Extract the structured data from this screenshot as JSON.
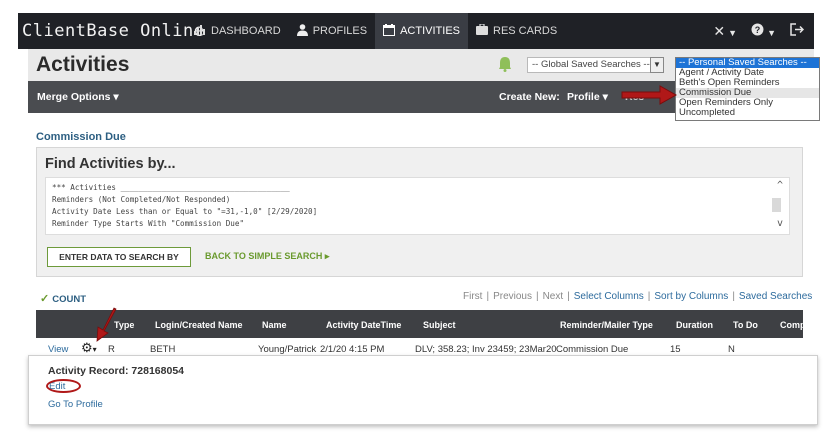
{
  "app": {
    "title": "ClientBase Online"
  },
  "nav": {
    "items": [
      {
        "label": "DASHBOARD",
        "icon": "bar-chart-icon",
        "active": false
      },
      {
        "label": "PROFILES",
        "icon": "person-icon",
        "active": false
      },
      {
        "label": "ACTIVITIES",
        "icon": "calendar-icon",
        "active": true
      },
      {
        "label": "RES CARDS",
        "icon": "suitcase-icon",
        "active": false
      }
    ],
    "right_icons": [
      "tools-icon",
      "help-icon",
      "logout-icon"
    ]
  },
  "page": {
    "title": "Activities",
    "global_search_placeholder": "-- Global Saved Searches --"
  },
  "toolbar": {
    "merge_label": "Merge Options",
    "create_label": "Create New:",
    "profile_label": "Profile",
    "hidden_label": "Res"
  },
  "personal_saved_searches": {
    "header": "-- Personal Saved Searches --",
    "options": [
      "Agent / Activity Date",
      "Beth's Open Reminders",
      "Commission Due",
      "Open Reminders Only",
      "Uncompleted"
    ],
    "selected": "Commission Due"
  },
  "search": {
    "subtitle": "Commission Due",
    "find_title": "Find Activities by...",
    "criteria": [
      "*** Activities _____________________________________",
      "Reminders (Not Completed/Not Responded)",
      "Activity Date Less than or Equal to \"=31,-1,0\" [2/29/2020]",
      "Reminder Type Starts With \"Commission Due\""
    ],
    "enter_label": "ENTER DATA TO SEARCH BY",
    "back_label": "BACK TO SIMPLE SEARCH"
  },
  "results": {
    "count_label": "COUNT",
    "pager": {
      "first": "First",
      "previous": "Previous",
      "next": "Next",
      "select_columns": "Select Columns",
      "sort_by_columns": "Sort by Columns",
      "saved_searches": "Saved Searches"
    },
    "columns": [
      "Type",
      "Login/Created Name",
      "Name",
      "Activity DateTime",
      "Subject",
      "Reminder/Mailer Type",
      "Duration",
      "To Do",
      "Comp"
    ],
    "rows": [
      {
        "view": "View",
        "type": "R",
        "login": "BETH",
        "name": "Young/Patrick",
        "datetime": "2/1/20 4:15 PM",
        "subject": "DLV; 358.23; Inv 23459; 23Mar20",
        "reminder_type": "Commission Due",
        "duration": "15",
        "todo": "N"
      }
    ]
  },
  "popup": {
    "title": "Activity Record: 728168054",
    "edit": "Edit",
    "goto": "Go To Profile"
  },
  "annotation_color": "#b01818"
}
